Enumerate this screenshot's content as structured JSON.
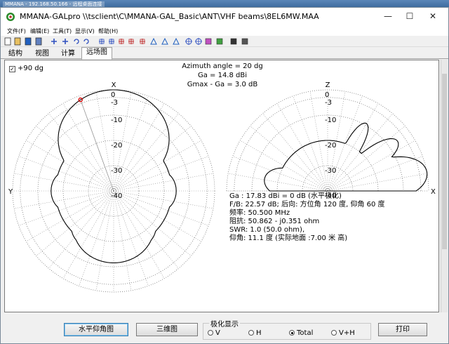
{
  "remote_session": {
    "title": "MMANA - 192.168.50.166 - 远程桌面连接"
  },
  "window": {
    "title": "MMANA-GALpro \\\\tsclient\\C\\MMANA-GAL_Basic\\ANT\\VHF beams\\8EL6MW.MAA",
    "minimize": "—",
    "maximize": "☐",
    "close": "✕"
  },
  "menu": [
    "文件(F)",
    "编辑(E)",
    "工具(T)",
    "显示(V)",
    "帮助(H)"
  ],
  "toolbar_icons": [
    "new-file-icon",
    "open-file-icon",
    "save-icon",
    "copy-icon",
    "add-icon",
    "remove-icon",
    "undo-icon",
    "redo-icon",
    "move-icon",
    "rotate-icon",
    "wire-icon",
    "segment-icon",
    "grid-icon",
    "pencil-icon",
    "line-icon",
    "triangle-icon",
    "target-icon",
    "crosshair-icon",
    "paint-icon",
    "color-icon",
    "tools-icon",
    "table-icon"
  ],
  "tabs": [
    "结构",
    "视图",
    "计算",
    "远场图"
  ],
  "active_tab": 3,
  "plot": {
    "checkbox_label": "+90 dg",
    "checkbox_checked": true,
    "azimuth": "Azimuth angle = 20 dg",
    "ga": "Ga = 14.8 dBi",
    "gmax": "Gmax - Ga = 3.0 dB",
    "left_axis_top": "X",
    "left_axis_left": "Y",
    "right_axis_top": "Z",
    "right_axis_right": "X",
    "ring_labels_left": [
      "0",
      "-3",
      "-10",
      "-20",
      "-30",
      "-40"
    ],
    "ring_labels_right": [
      "0",
      "-3",
      "-10",
      "-20",
      "-30",
      "-40"
    ],
    "info_lines": [
      "Ga : 17.83 dBi = 0 dB  (水平极化)",
      "F/B: 22.57 dB; 后向: 方位角 120 度, 仰角 60 度",
      "频率: 50.500 MHz",
      "阻抗: 50.862 - j0.351 ohm",
      "SWR: 1.0 (50.0 ohm),",
      "仰角: 11.1 度 (实际地面  :7.00 米 高)"
    ],
    "pattern_color": "#000000",
    "marker_color": "#e00000"
  },
  "bottom": {
    "btn_elevation": "水平仰角图",
    "btn_3d": "三维图",
    "polarization_label": "极化显示",
    "radio_v": "V",
    "radio_h": "H",
    "radio_total": "Total",
    "radio_vh": "V+H",
    "selected": "Total",
    "btn_print": "打印"
  }
}
